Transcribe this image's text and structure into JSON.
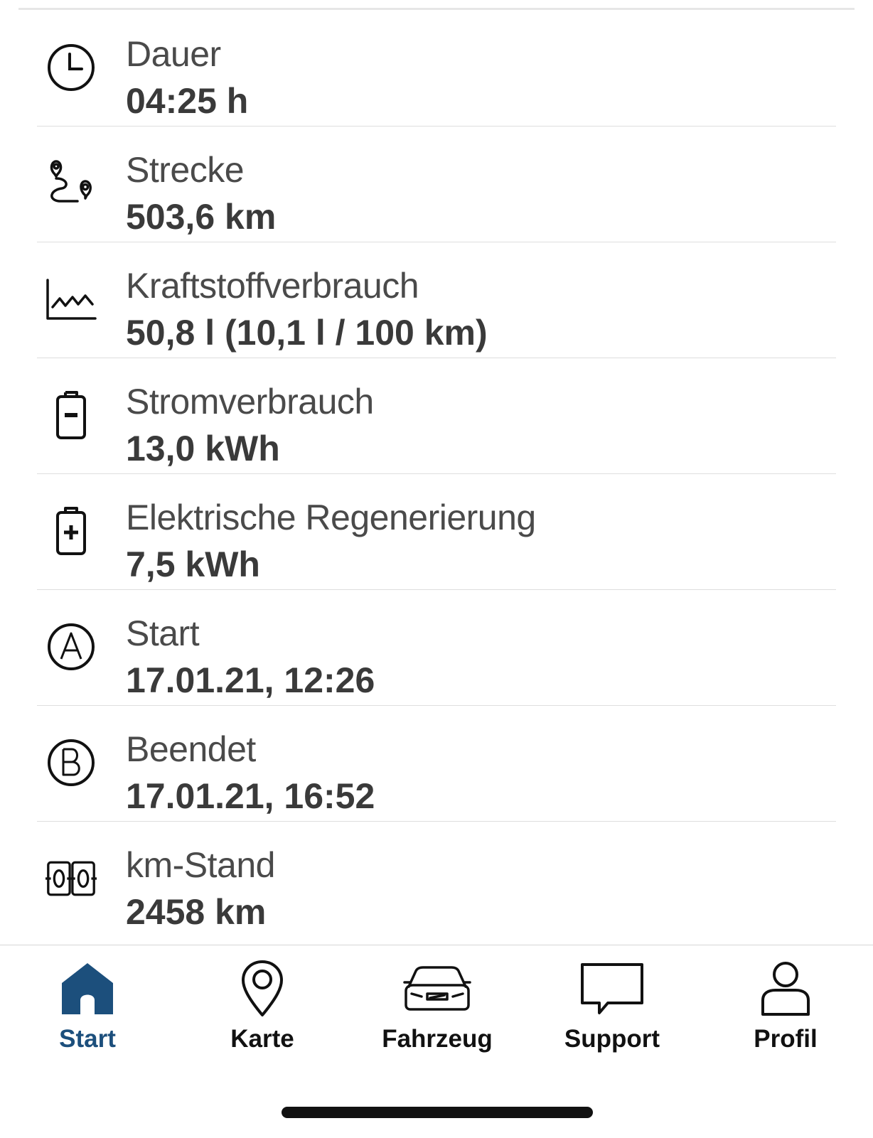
{
  "details": [
    {
      "icon": "clock-icon",
      "label": "Dauer",
      "value": "04:25 h"
    },
    {
      "icon": "route-icon",
      "label": "Strecke",
      "value": "503,6 km"
    },
    {
      "icon": "consumption-chart-icon",
      "label": "Kraftstoffverbrauch",
      "value": "50,8 l (10,1 l / 100 km)"
    },
    {
      "icon": "battery-minus-icon",
      "label": "Stromverbrauch",
      "value": "13,0 kWh"
    },
    {
      "icon": "battery-plus-icon",
      "label": "Elektrische Regenerierung",
      "value": "7,5 kWh"
    },
    {
      "icon": "start-point-a-icon",
      "label": "Start",
      "value": "17.01.21, 12:26"
    },
    {
      "icon": "end-point-b-icon",
      "label": "Beendet",
      "value": "17.01.21, 16:52"
    },
    {
      "icon": "odometer-icon",
      "label": "km-Stand",
      "value": "2458 km"
    }
  ],
  "tabbar": {
    "items": [
      {
        "icon": "home-icon",
        "label": "Start",
        "active": true
      },
      {
        "icon": "map-pin-icon",
        "label": "Karte",
        "active": false
      },
      {
        "icon": "car-icon",
        "label": "Fahrzeug",
        "active": false
      },
      {
        "icon": "chat-bubble-icon",
        "label": "Support",
        "active": false
      },
      {
        "icon": "user-icon",
        "label": "Profil",
        "active": false
      }
    ]
  },
  "colors": {
    "accent": "#1c4f7c",
    "text": "#3a3a3a",
    "separator": "#dedede"
  }
}
